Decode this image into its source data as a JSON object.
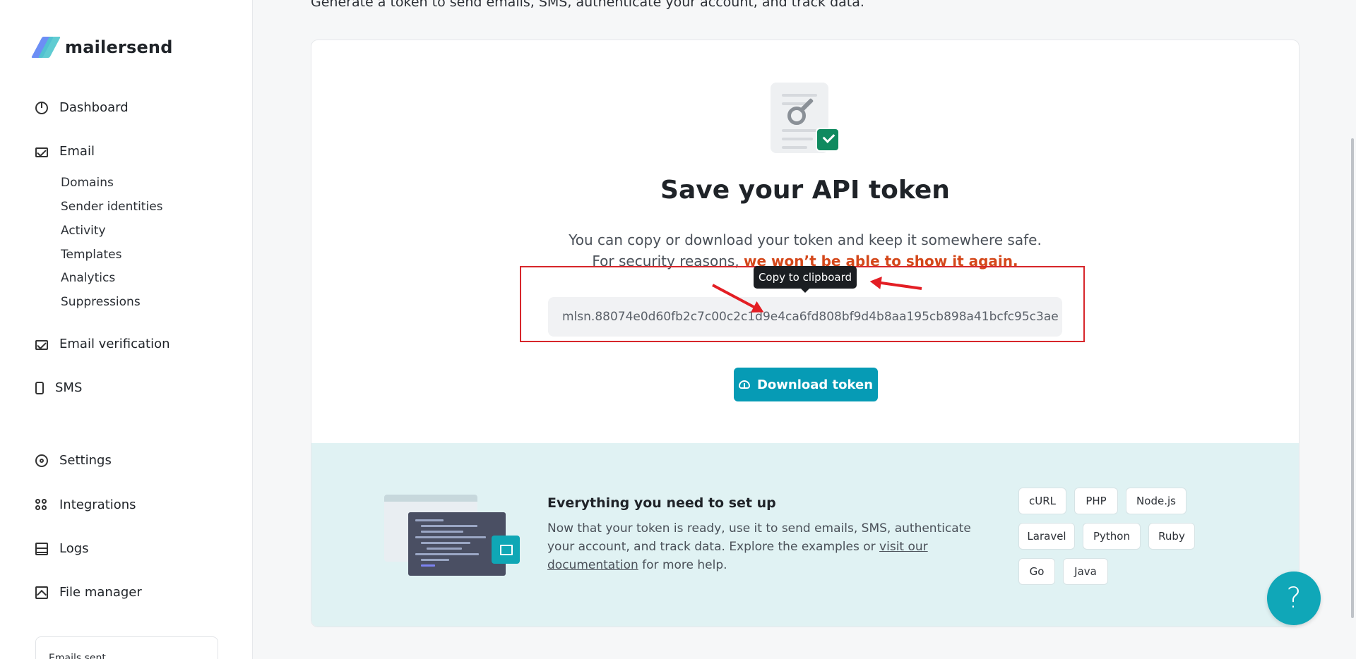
{
  "app": {
    "brand": "mailersend"
  },
  "sidebar": {
    "items": [
      {
        "label": "Dashboard",
        "icon": "dashboard-icon"
      },
      {
        "label": "Email",
        "icon": "email-icon"
      },
      {
        "label": "Email verification",
        "icon": "email-verification-icon"
      },
      {
        "label": "SMS",
        "icon": "sms-icon"
      },
      {
        "label": "Settings",
        "icon": "gear-icon"
      },
      {
        "label": "Integrations",
        "icon": "integrations-icon"
      },
      {
        "label": "Logs",
        "icon": "logs-icon"
      },
      {
        "label": "File manager",
        "icon": "file-manager-icon"
      }
    ],
    "email_sub": [
      "Domains",
      "Sender identities",
      "Activity",
      "Templates",
      "Analytics",
      "Suppressions"
    ],
    "emails_sent_label": "Emails sent"
  },
  "main": {
    "top_desc": "Generate a token to send emails, SMS, authenticate your account, and track data.",
    "hero": {
      "title": "Save your API token",
      "line1": "You can copy or download your token and keep it somewhere safe.",
      "line2_prefix": "For security reasons, ",
      "line2_warning": "we won’t be able to show it again.",
      "token": "mlsn.88074e0d60fb2c7c00c2c1d9e4ca6fd808bf9d4b8aa195cb898a41bcfc95c3ae",
      "tooltip": "Copy to clipboard",
      "download_label": "Download token"
    },
    "setup": {
      "title": "Everything you need to set up",
      "desc_prefix": "Now that your token is ready, use it to send emails, SMS, authenticate your account, and track data. Explore the examples or ",
      "desc_link": "visit our documentation",
      "desc_suffix": " for more help.",
      "chips": [
        "cURL",
        "PHP",
        "Node.js",
        "Laravel",
        "Python",
        "Ruby",
        "Go",
        "Java"
      ]
    }
  },
  "help": {
    "label": "?"
  },
  "colors": {
    "accent": "#069bb5",
    "warning": "#d4471a",
    "annotation": "#e31e24",
    "success": "#0f8a5f"
  }
}
